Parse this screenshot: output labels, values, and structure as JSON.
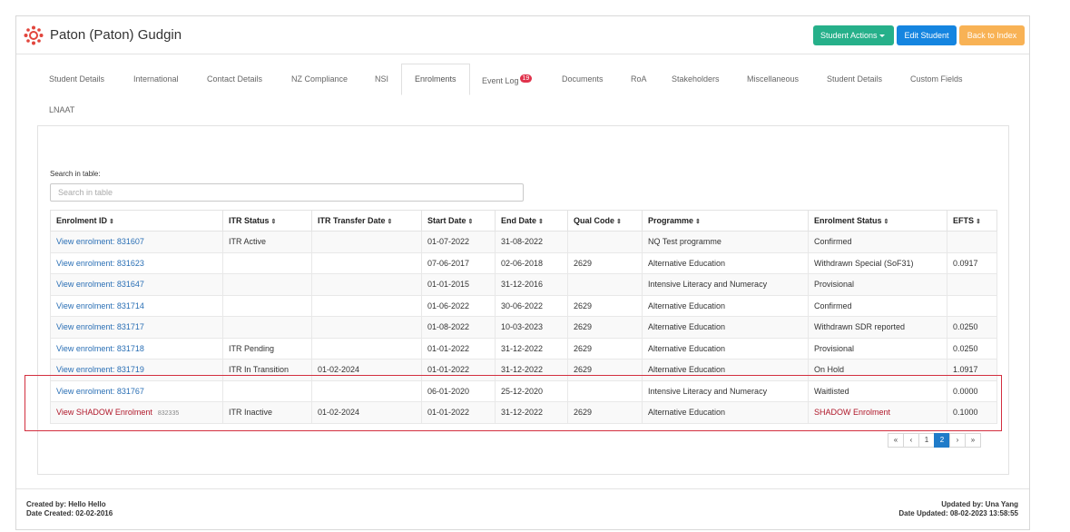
{
  "student": {
    "name": "Paton (Paton) Gudgin"
  },
  "buttons": {
    "student_actions": "Student Actions",
    "edit_student": "Edit Student",
    "back_to_index": "Back to Index"
  },
  "tabs": [
    {
      "label": "Student Details"
    },
    {
      "label": "International"
    },
    {
      "label": "Contact Details"
    },
    {
      "label": "NZ Compliance"
    },
    {
      "label": "NSI"
    },
    {
      "label": "Enrolments"
    },
    {
      "label": "Event Log",
      "badge": "19"
    },
    {
      "label": "Documents"
    },
    {
      "label": "RoA"
    },
    {
      "label": "Stakeholders"
    },
    {
      "label": "Miscellaneous"
    },
    {
      "label": "Student Details"
    },
    {
      "label": "Custom Fields"
    },
    {
      "label": "LNAAT"
    }
  ],
  "active_tab": "Enrolments",
  "search": {
    "label": "Search in table:",
    "placeholder": "Search in table",
    "value": ""
  },
  "table": {
    "headers": [
      "Enrolment ID",
      "ITR Status",
      "ITR Transfer Date",
      "Start Date",
      "End Date",
      "Qual Code",
      "Programme",
      "Enrolment Status",
      "EFTS"
    ],
    "rows": [
      [
        "View enrolment: 831607",
        "ITR Active",
        "",
        "01-07-2022",
        "31-08-2022",
        "",
        "NQ Test programme",
        "Confirmed",
        ""
      ],
      [
        "View enrolment: 831623",
        "",
        "",
        "07-06-2017",
        "02-06-2018",
        "2629",
        "Alternative Education",
        "Withdrawn Special (SoF31)",
        "0.0917"
      ],
      [
        "View enrolment: 831647",
        "",
        "",
        "01-01-2015",
        "31-12-2016",
        "",
        "Intensive Literacy and Numeracy",
        "Provisional",
        ""
      ],
      [
        "View enrolment: 831714",
        "",
        "",
        "01-06-2022",
        "30-06-2022",
        "2629",
        "Alternative Education",
        "Confirmed",
        ""
      ],
      [
        "View enrolment: 831717",
        "",
        "",
        "01-08-2022",
        "10-03-2023",
        "2629",
        "Alternative Education",
        "Withdrawn SDR reported",
        "0.0250"
      ],
      [
        "View enrolment: 831718",
        "ITR Pending",
        "",
        "01-01-2022",
        "31-12-2022",
        "2629",
        "Alternative Education",
        "Provisional",
        "0.0250"
      ],
      [
        "View enrolment: 831719",
        "ITR In Transition",
        "01-02-2024",
        "01-01-2022",
        "31-12-2022",
        "2629",
        "Alternative Education",
        "On Hold",
        "1.0917"
      ],
      [
        "View enrolment: 831767",
        "",
        "",
        "06-01-2020",
        "25-12-2020",
        "",
        "Intensive Literacy and Numeracy",
        "Waitlisted",
        "0.0000"
      ]
    ],
    "shadow_row": {
      "link": "View SHADOW Enrolment",
      "id": "832335",
      "itr_status": "ITR Inactive",
      "itr_transfer_date": "01-02-2024",
      "start_date": "01-01-2022",
      "end_date": "31-12-2022",
      "qual_code": "2629",
      "programme": "Alternative Education",
      "status": "SHADOW Enrolment",
      "efts": "0.1000"
    }
  },
  "pagination": {
    "first": "«",
    "prev": "‹",
    "pages": [
      "1",
      "2"
    ],
    "current": "2",
    "next": "›",
    "last": "»"
  },
  "footer": {
    "created_by": "Created by: Hello Hello",
    "date_created": "Date Created: 02-02-2016",
    "updated_by": "Updated by: Una Yang",
    "date_updated": "Date Updated: 08-02-2023 13:58:55"
  },
  "colors": {
    "primary": "#1585e0",
    "success": "#26b08a",
    "warning": "#f8b255",
    "danger": "#d32f3f",
    "link": "#2a6fb5"
  }
}
